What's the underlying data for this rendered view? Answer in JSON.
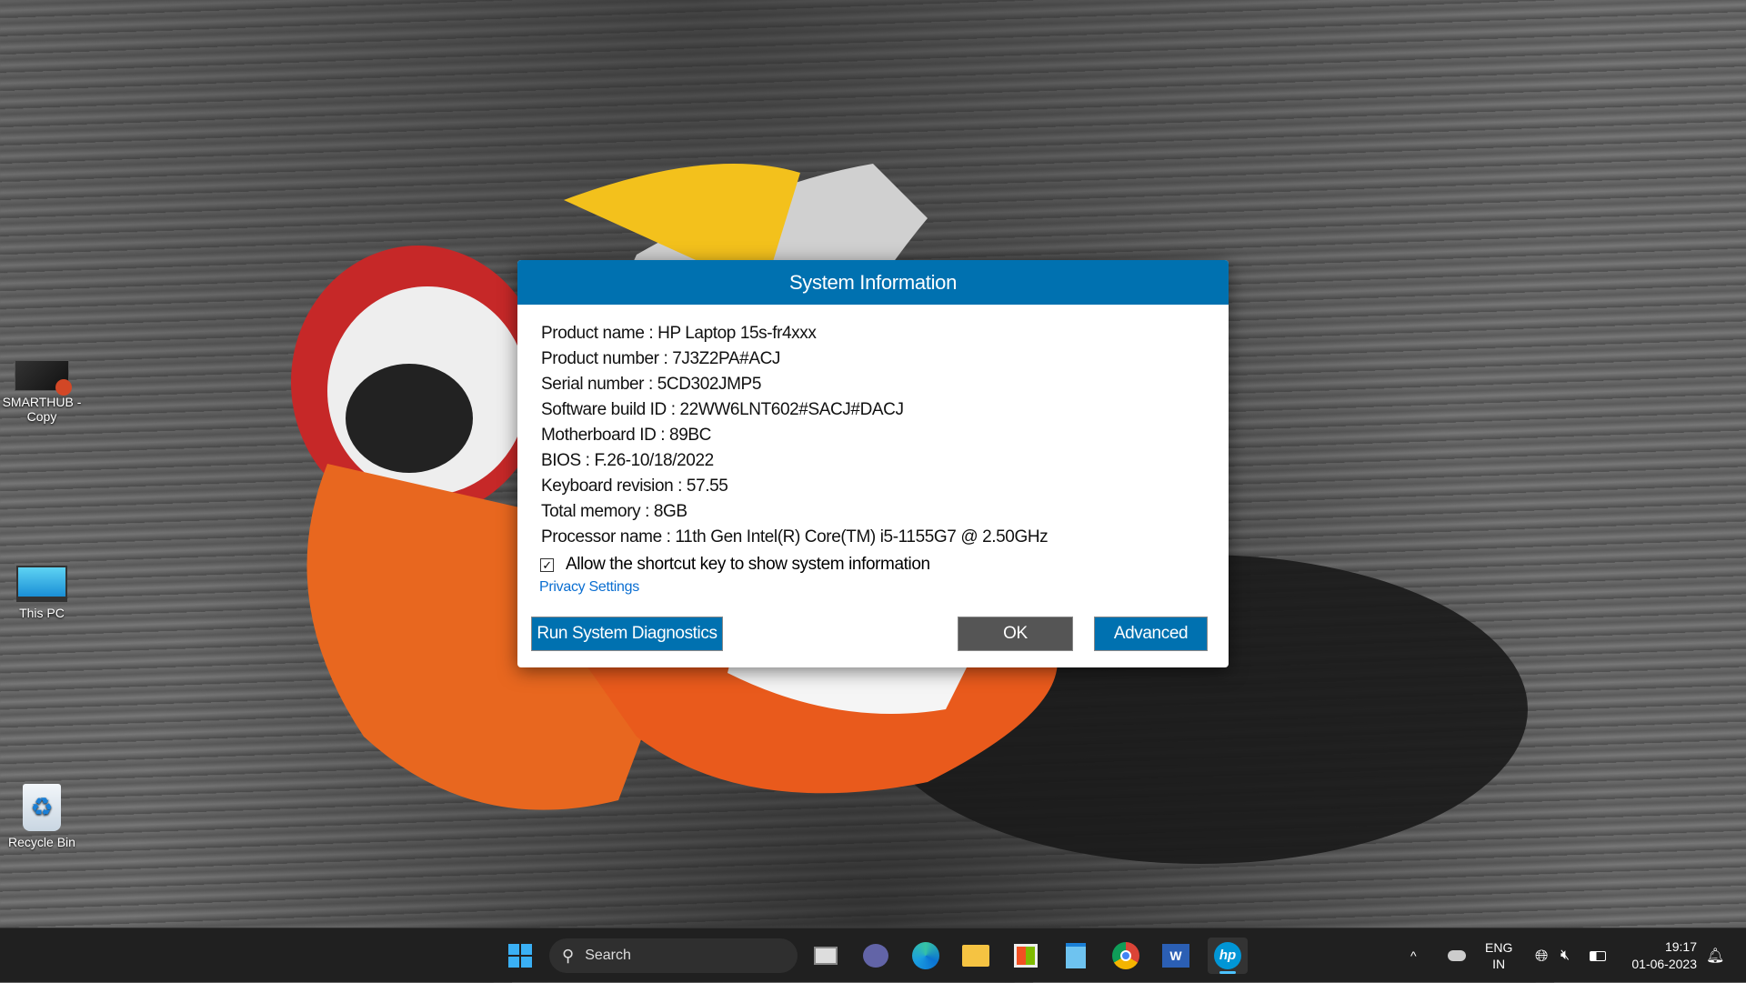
{
  "desktop": {
    "icons": [
      {
        "label": "SMARTHUB - Copy"
      },
      {
        "label": "This PC"
      },
      {
        "label": "Recycle Bin"
      }
    ]
  },
  "dialog": {
    "title": "System Information",
    "lines": [
      "Product name : HP Laptop 15s-fr4xxx",
      "Product number : 7J3Z2PA#ACJ",
      "Serial number : 5CD302JMP5",
      "Software build ID : 22WW6LNT602#SACJ#DACJ",
      "Motherboard ID : 89BC",
      "BIOS : F.26-10/18/2022",
      "Keyboard revision : 57.55",
      "Total memory : 8GB",
      "Processor name : 11th Gen Intel(R) Core(TM) i5-1155G7 @ 2.50GHz"
    ],
    "checkbox_label": "Allow the shortcut key to show system information",
    "checkbox_checked": true,
    "privacy_link": "Privacy Settings",
    "run_diagnostics": "Run System Diagnostics",
    "ok": "OK",
    "advanced": "Advanced",
    "colors": {
      "accent": "#0071b0",
      "ok_button": "#555555"
    }
  },
  "taskbar": {
    "search_placeholder": "Search",
    "apps": [
      "start-icon",
      "task-view-icon",
      "teams-chat-icon",
      "edge-icon",
      "file-explorer-icon",
      "microsoft-store-icon",
      "notepad-icon",
      "chrome-icon",
      "word-icon",
      "hp-icon"
    ],
    "lang": "ENG",
    "region": "IN",
    "time": "19:17",
    "date": "01-06-2023"
  }
}
